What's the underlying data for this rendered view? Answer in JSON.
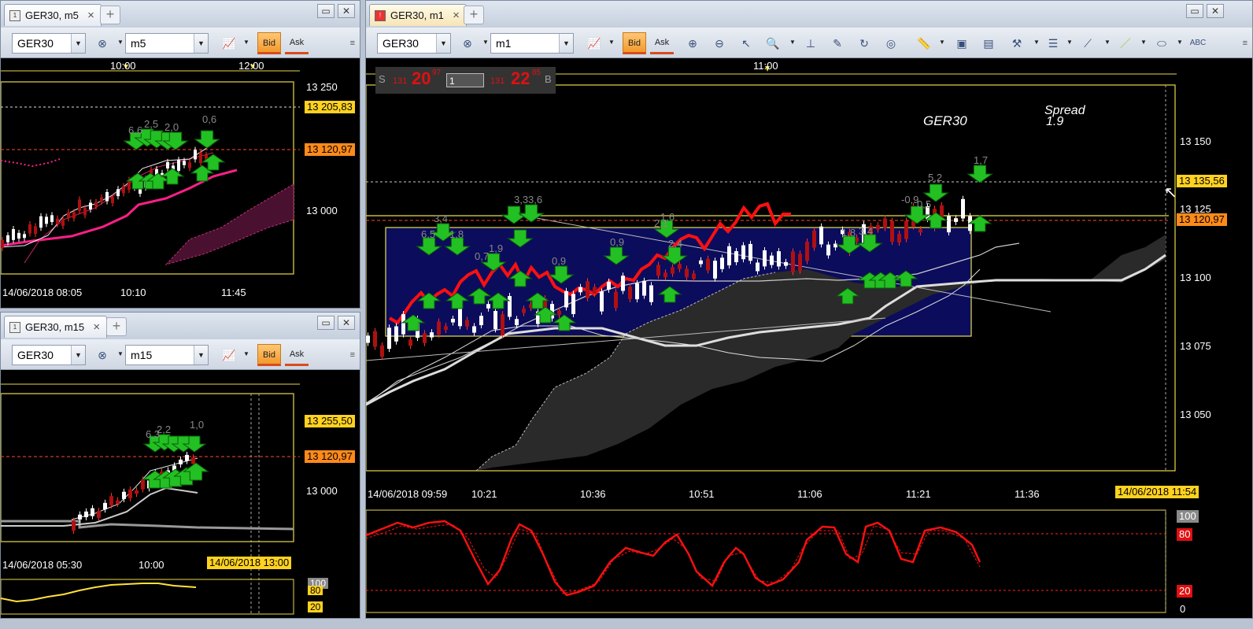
{
  "symbol": "GER30",
  "colors": {
    "bull_arrow": "#22c022",
    "bear_arrow": "#22c022",
    "price_line": "#ff1010",
    "accent": "#f29a2d"
  },
  "left_top": {
    "tab_title": "GER30, m5",
    "symbol_value": "GER30",
    "timeframe_value": "m5",
    "bid_label": "Bid",
    "ask_label": "Ask",
    "top_times": [
      "10:00",
      "12:00"
    ],
    "price_labels": [
      "13 250",
      "13 000"
    ],
    "price_tags": {
      "line1": "13 205,83",
      "line2": "13 120,97"
    },
    "bottom_times": [
      "14/06/2018 08:05",
      "10:10",
      "11:45"
    ],
    "signal_labels": [
      "6,6",
      "2,5",
      "2,0",
      "0,6",
      "7",
      "2,0"
    ]
  },
  "left_bottom": {
    "tab_title": "GER30, m15",
    "symbol_value": "GER30",
    "timeframe_value": "m15",
    "bid_label": "Bid",
    "ask_label": "Ask",
    "price_labels": [
      "13 000"
    ],
    "price_tags": {
      "line1": "13 255,50",
      "line2": "13 120,97"
    },
    "bottom_times": [
      "14/06/2018 05:30",
      "10:00"
    ],
    "crosshair_time": "14/06/2018 13:00",
    "signal_labels": [
      "6,3",
      "2,2",
      "2,0",
      "1,0"
    ],
    "osc_labels": [
      "100",
      "80",
      "20"
    ]
  },
  "main": {
    "tab_title": "GER30, m1",
    "symbol_value": "GER30",
    "timeframe_value": "m1",
    "bid_label": "Bid",
    "ask_label": "Ask",
    "top_time": "11:00",
    "quote": {
      "sell_prefix": "S",
      "sell_small": "131",
      "sell_big": "20",
      "sell_sup": "97",
      "lot": "1",
      "buy_small": "131",
      "buy_big": "22",
      "buy_sup": "85",
      "buy_suffix": "B"
    },
    "watermark_symbol": "GER30",
    "spread_label": "Spread",
    "spread_value": "1.9",
    "price_labels": [
      "13 150",
      "13 125",
      "13 100",
      "13 075",
      "13 050"
    ],
    "price_tags": {
      "line1": "13 135,56",
      "line2": "13 120,97"
    },
    "bottom_times": [
      "14/06/2018 09:59",
      "10:21",
      "10:36",
      "10:51",
      "11:06",
      "11:21",
      "11:36"
    ],
    "crosshair_time": "14/06/2018 11:54",
    "signal_labels": [
      "3,4",
      "6,5",
      "1,8",
      "0,7",
      "1,9",
      "1,3",
      "3,3",
      "3,6",
      "1,0",
      "0,9",
      "0,0",
      "0,9",
      "2,1",
      "1,6",
      "2,4",
      "1,8",
      "3,4",
      "1,6",
      "5,2",
      "1,7",
      "-0,9",
      "0,5",
      "1,8"
    ],
    "osc_labels": [
      "100",
      "80",
      "20",
      "0"
    ]
  }
}
